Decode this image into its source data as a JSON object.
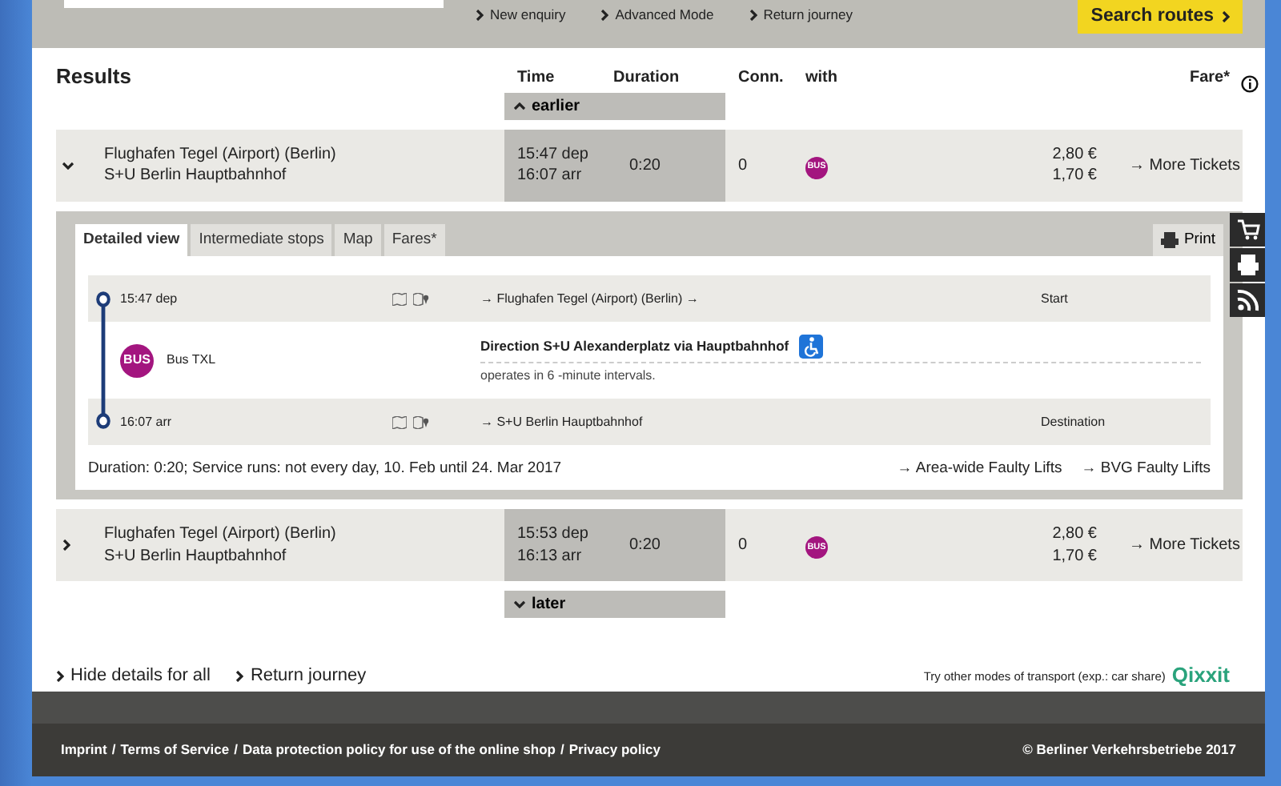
{
  "top_bar": {
    "links": [
      "New enquiry",
      "Advanced Mode",
      "Return journey"
    ],
    "search_button": "Search routes"
  },
  "results": {
    "title": "Results",
    "columns": [
      "Time",
      "Duration",
      "Conn.",
      "with",
      "Fare*"
    ],
    "earlier": "earlier",
    "later": "later",
    "connections": [
      {
        "expanded": true,
        "from": "Flughafen Tegel (Airport) (Berlin)",
        "to": "S+U Berlin Hauptbahnhof",
        "dep": "15:47 dep",
        "arr": "16:07 arr",
        "duration": "0:20",
        "changes": "0",
        "mode": "BUS",
        "fares": [
          "2,80 €",
          "1,70 €"
        ],
        "more": "→ More Tickets",
        "details": {
          "tabs": [
            {
              "label": "Detailed view",
              "selected": true
            },
            {
              "label": "Intermediate stops",
              "selected": false
            },
            {
              "label": "Map",
              "selected": false
            },
            {
              "label": "Fares*",
              "selected": false
            }
          ],
          "print": "Print",
          "legs": [
            {
              "kind": "stop",
              "time": "15:47 dep",
              "place": "→ Flughafen Tegel (Airport) (Berlin) →",
              "role": "Start"
            },
            {
              "kind": "ride",
              "mode": "BUS",
              "line": "Bus TXL",
              "direction": "Direction S+U Alexanderplatz via Hauptbahnhof",
              "accessible": true,
              "note": "operates in 6 -minute intervals."
            },
            {
              "kind": "stop",
              "time": "16:07 arr",
              "place": "→ S+U Berlin Hauptbahnhof",
              "role": "Destination"
            }
          ],
          "summary": "Duration: 0:20; Service runs: not every day, 10. Feb until 24. Mar 2017",
          "links": [
            "→ Area-wide Faulty Lifts",
            "→ BVG Faulty Lifts"
          ]
        }
      },
      {
        "expanded": false,
        "from": "Flughafen Tegel (Airport) (Berlin)",
        "to": "S+U Berlin Hauptbahnhof",
        "dep": "15:53 dep",
        "arr": "16:13 arr",
        "duration": "0:20",
        "changes": "0",
        "mode": "BUS",
        "fares": [
          "2,80 €",
          "1,70 €"
        ],
        "more": "→ More Tickets"
      }
    ]
  },
  "bottom_links": [
    "Hide details for all",
    "Return journey"
  ],
  "other_modes": {
    "text": "Try other modes of transport (exp.: car share)",
    "logo": "Qixxit"
  },
  "footer": {
    "links": [
      "Imprint",
      "Terms of Service",
      "Data protection policy for use of the online shop",
      "Privacy policy"
    ],
    "separator": "/",
    "copyright": "© Berliner Verkehrsbetriebe 2017"
  }
}
